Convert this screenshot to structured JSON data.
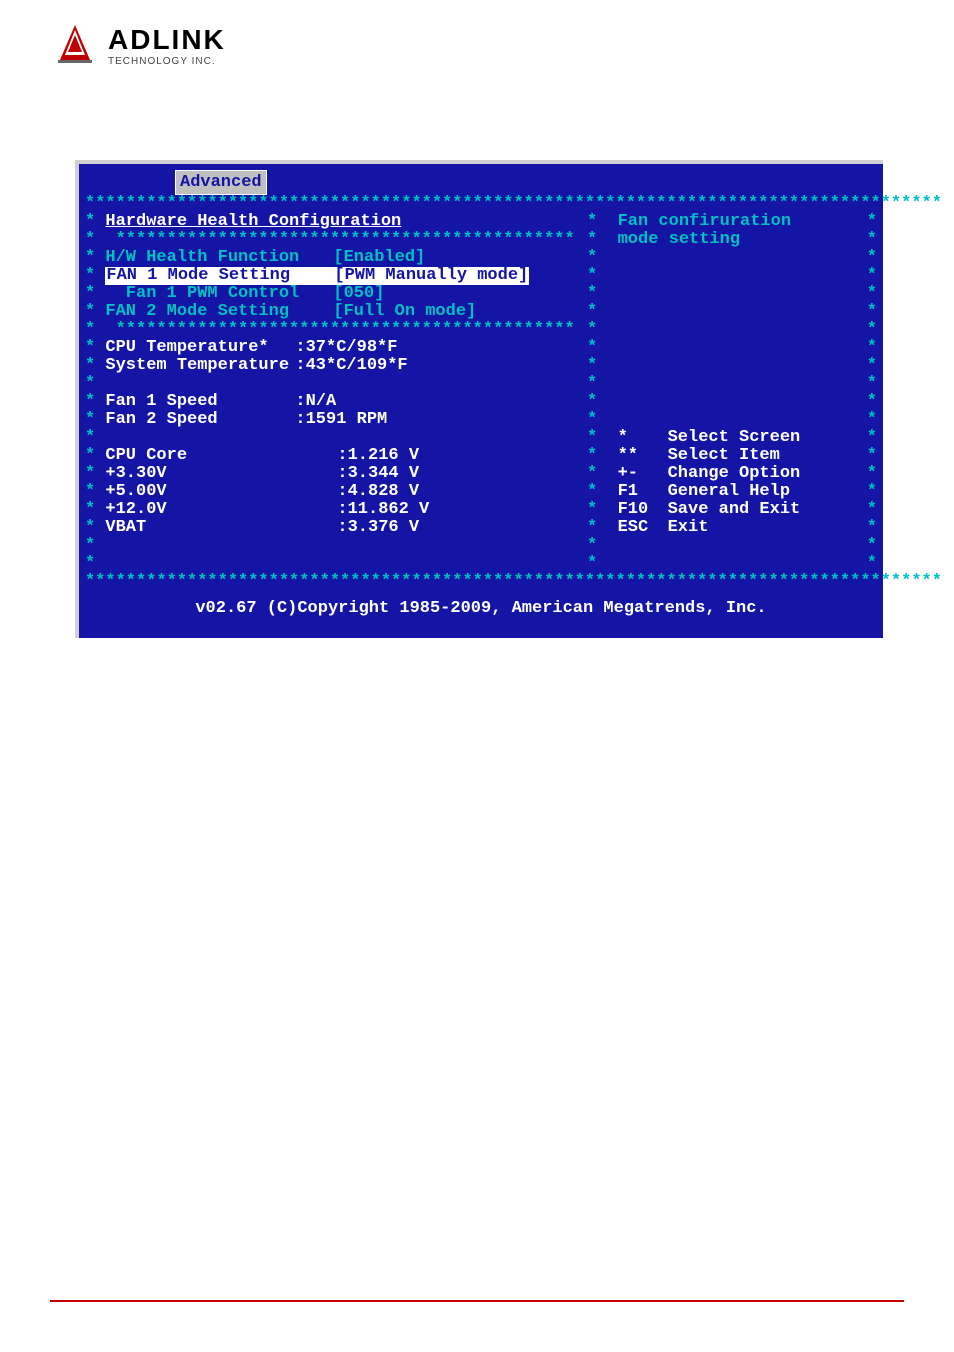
{
  "logo": {
    "main": "ADLINK",
    "sub": "TECHNOLOGY INC."
  },
  "bios": {
    "tab": "Advanced",
    "section_title": "Hardware Health Configuration",
    "help_title_1": "Fan confiruration",
    "help_title_2": "mode setting",
    "settings": [
      {
        "label": "H/W Health Function",
        "value": "[Enabled]",
        "label_cls": "cyan",
        "value_cls": "cyan"
      },
      {
        "label": "FAN 1 Mode Setting",
        "value": "[PWM Manually mode]",
        "label_cls": "highlight",
        "value_cls": "highlight"
      },
      {
        "label": "  Fan 1 PWM Control",
        "value": "[050]",
        "label_cls": "cyan",
        "value_cls": "cyan"
      },
      {
        "label": "FAN 2 Mode Setting",
        "value": "[Full On mode]",
        "label_cls": "cyan",
        "value_cls": "cyan"
      }
    ],
    "readings_1": [
      {
        "label": "CPU Temperature*",
        "value": ":37*C/98*F"
      },
      {
        "label": "System Temperature",
        "value": ":43*C/109*F"
      }
    ],
    "readings_2": [
      {
        "label": "Fan 1 Speed",
        "value": ":N/A"
      },
      {
        "label": "Fan 2 Speed",
        "value": ":1591 RPM"
      }
    ],
    "readings_3": [
      {
        "label": "CPU Core",
        "value": ":1.216 V"
      },
      {
        "label": "+3.30V",
        "value": ":3.344 V"
      },
      {
        "label": "+5.00V",
        "value": ":4.828 V"
      },
      {
        "label": "+12.0V",
        "value": ":11.862 V"
      },
      {
        "label": "VBAT",
        "value": ":3.376 V"
      }
    ],
    "nav_help": [
      {
        "key": "*",
        "label": "Select Screen"
      },
      {
        "key": "**",
        "label": "Select Item"
      },
      {
        "key": "+-",
        "label": "Change Option"
      },
      {
        "key": "F1",
        "label": "General Help"
      },
      {
        "key": "F10",
        "label": "Save and Exit"
      },
      {
        "key": "ESC",
        "label": "Exit"
      }
    ],
    "footer": "v02.67 (C)Copyright 1985-2009, American Megatrends, Inc."
  }
}
